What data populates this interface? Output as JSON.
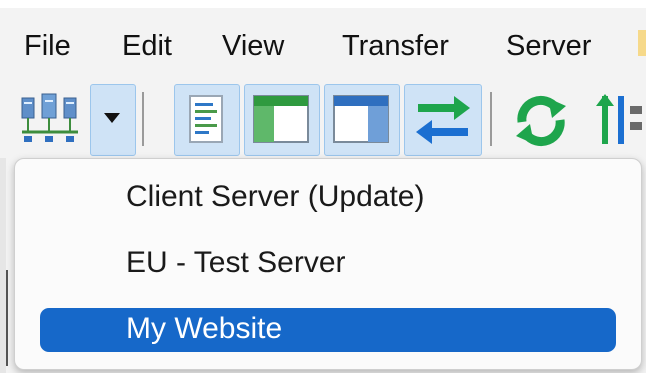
{
  "menubar": {
    "items": [
      "File",
      "Edit",
      "View",
      "Transfer",
      "Server"
    ]
  },
  "toolbar": {
    "icons": [
      "site-manager-icon",
      "dropdown-arrow-icon",
      "message-log-icon",
      "local-tree-icon",
      "remote-tree-icon",
      "transfer-queue-icon",
      "refresh-icon",
      "filter-icon"
    ]
  },
  "dropdown": {
    "items": [
      {
        "label": "Client Server (Update)"
      },
      {
        "label": "EU - Test Server"
      },
      {
        "label": "My Website"
      }
    ],
    "selected_index": 2
  },
  "colors": {
    "selection": "#1668c9",
    "toolbar_highlight": "#cfe3f6",
    "refresh_green": "#1ea54c",
    "transfer_blue": "#1b6fd1"
  }
}
